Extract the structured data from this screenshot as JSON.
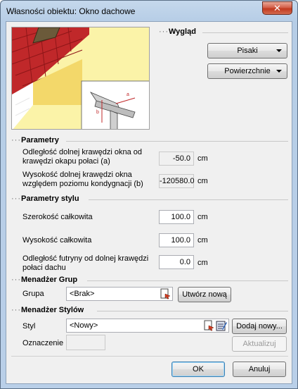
{
  "window": {
    "title": "Własności obiektu: Okno dachowe",
    "close_glyph": "✕"
  },
  "appearance": {
    "section_label": "Wygląd",
    "pens_button": "Pisaki",
    "surfaces_button": "Powierzchnie",
    "diagram_label_a": "a",
    "diagram_label_b": "b"
  },
  "parameters": {
    "section_label": "Parametry",
    "rows": [
      {
        "label_line1": "Odległość dolnej krawędzi okna od",
        "label_line2": "krawędzi okapu połaci (a)",
        "value": "-50.0",
        "unit": "cm"
      },
      {
        "label_line1": "Wysokość dolnej krawędzi okna",
        "label_line2": "względem poziomu kondygnacji (b)",
        "value": "-120580.0",
        "unit": "cm"
      }
    ]
  },
  "style_parameters": {
    "section_label": "Parametry stylu",
    "rows": [
      {
        "label_line1": "Szerokość całkowita",
        "label_line2": "",
        "value": "100.0",
        "unit": "cm"
      },
      {
        "label_line1": "Wysokość całkowita",
        "label_line2": "",
        "value": "100.0",
        "unit": "cm"
      },
      {
        "label_line1": "Odległość futryny od dolnej krawędzi",
        "label_line2": "połaci dachu",
        "value": "0.0",
        "unit": "cm"
      }
    ]
  },
  "group_manager": {
    "section_label": "Menadżer Grup",
    "group_label": "Grupa",
    "group_value": "<Brak>",
    "create_button": "Utwórz nową"
  },
  "style_manager": {
    "section_label": "Menadżer Stylów",
    "style_label": "Styl",
    "style_value": "<Nowy>",
    "add_new_button": "Dodaj nowy...",
    "designation_label": "Oznaczenie",
    "designation_value": "",
    "update_button": "Aktualizuj"
  },
  "footer": {
    "ok_button": "OK",
    "cancel_button": "Anuluj"
  },
  "colors": {
    "accent": "#3c7fb1",
    "roof_red": "#c0282a",
    "wall_yellow": "#fbf3a8"
  }
}
